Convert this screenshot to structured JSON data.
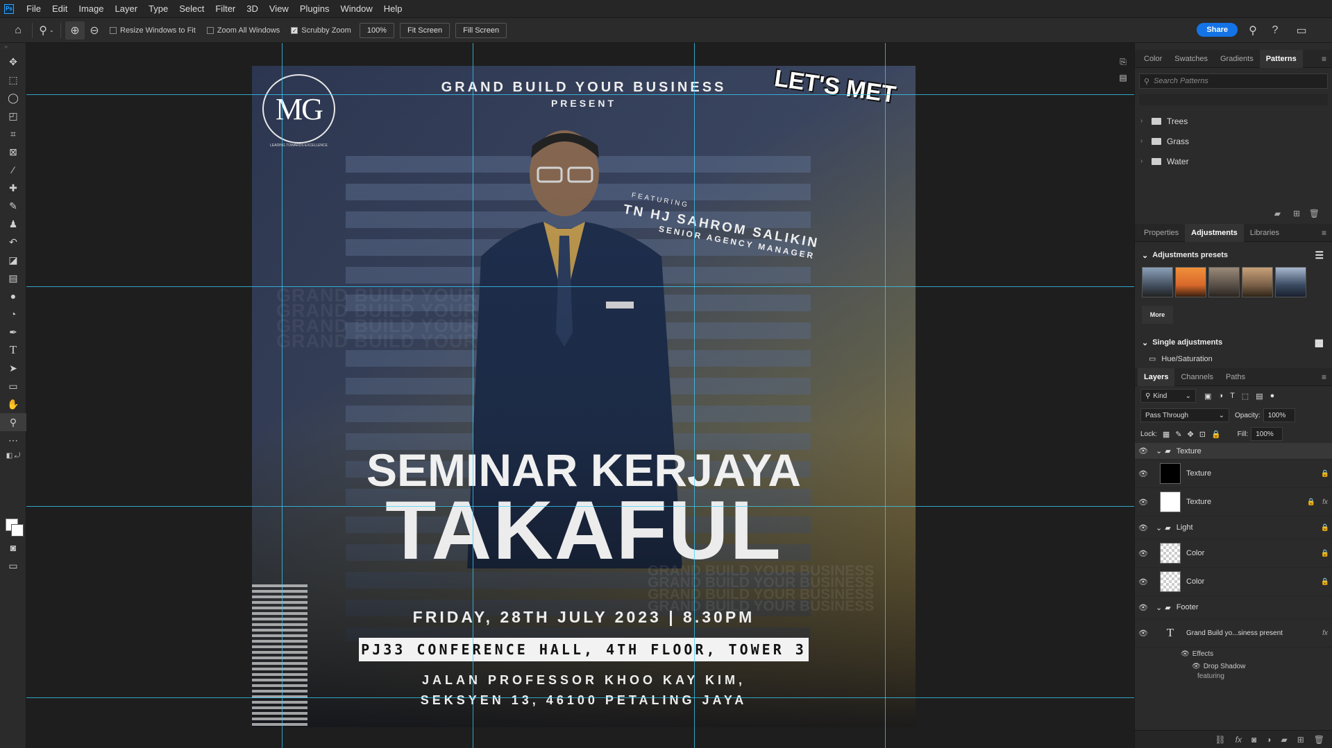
{
  "menu": [
    "File",
    "Edit",
    "Image",
    "Layer",
    "Type",
    "Select",
    "Filter",
    "3D",
    "View",
    "Plugins",
    "Window",
    "Help"
  ],
  "app_logo": "Ps",
  "options": {
    "resize_windows": "Resize Windows to Fit",
    "zoom_all": "Zoom All Windows",
    "scrubby_zoom": "Scrubby Zoom",
    "zoom_value": "100%",
    "fit_screen": "Fit Screen",
    "fill_screen": "Fill Screen",
    "share": "Share"
  },
  "poster": {
    "logo_text": "MG",
    "logo_caption": "LEADING TOWARDS EXCELLENCE",
    "lets_met": "LET'S MET",
    "header_line1": "GRAND BUILD YOUR BUSINESS",
    "header_line2": "PRESENT",
    "featuring": "FEATURING",
    "speaker_name": "TN HJ SAHROM SALIKIN",
    "speaker_title": "SENIOR AGENCY MANAGER",
    "ghost_text": "GRAND BUILD YOUR BUSINESS",
    "headline1": "SEMINAR KERJAYA",
    "headline2": "TAKAFUL",
    "date": "FRIDAY, 28TH JULY 2023 | 8.30PM",
    "venue": "PJ33 CONFERENCE HALL, 4TH FLOOR, TOWER 3",
    "address1": "JALAN PROFESSOR KHOO KAY KIM,",
    "address2": "SEKSYEN 13, 46100 PETALING JAYA"
  },
  "patterns_panel": {
    "tabs": [
      "Color",
      "Swatches",
      "Gradients",
      "Patterns"
    ],
    "active_tab": "Patterns",
    "search_placeholder": "Search Patterns",
    "folders": [
      "Trees",
      "Grass",
      "Water"
    ]
  },
  "adjustments_panel": {
    "tabs": [
      "Properties",
      "Adjustments",
      "Libraries"
    ],
    "active_tab": "Adjustments",
    "presets_label": "Adjustments presets",
    "preset_colors": [
      "#3a4452",
      "#d8682a",
      "#5a5048",
      "#7a6048",
      "#3a4a60"
    ],
    "more_label": "More",
    "single_label": "Single adjustments",
    "hue_saturation": "Hue/Saturation"
  },
  "layers_panel": {
    "tabs": [
      "Layers",
      "Channels",
      "Paths"
    ],
    "active_tab": "Layers",
    "filter_kind": "Kind",
    "blend_mode": "Pass Through",
    "opacity_label": "Opacity:",
    "opacity_value": "100%",
    "lock_label": "Lock:",
    "fill_label": "Fill:",
    "fill_value": "100%",
    "layers": [
      {
        "name": "Texture",
        "type": "group"
      },
      {
        "name": "Texture",
        "type": "black"
      },
      {
        "name": "Texture",
        "type": "white",
        "fx": "fx"
      },
      {
        "name": "Light",
        "type": "group"
      },
      {
        "name": "Color",
        "type": "transparent"
      },
      {
        "name": "Color",
        "type": "transparent"
      },
      {
        "name": "Footer",
        "type": "group"
      },
      {
        "name": "Grand Build yo...siness present",
        "type": "text",
        "fx": "fx"
      }
    ],
    "effects_label": "Effects",
    "drop_shadow": "Drop Shadow",
    "partial_layer": "featuring"
  }
}
